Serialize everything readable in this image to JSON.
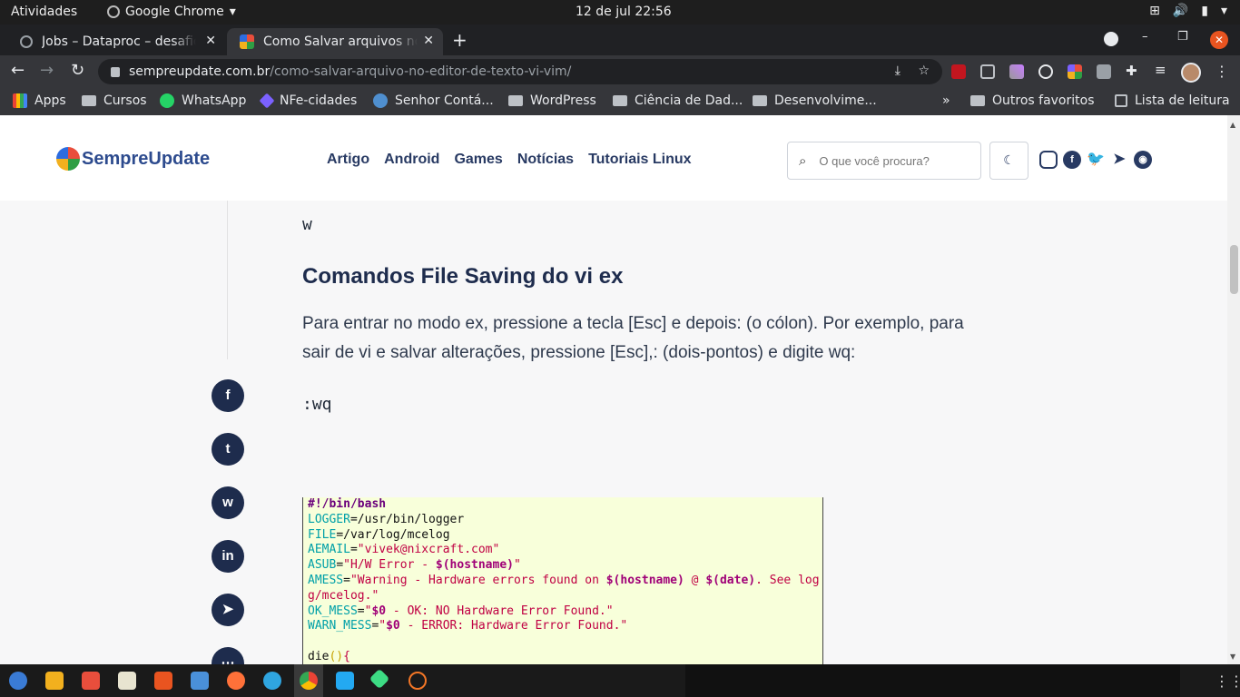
{
  "os": {
    "activities": "Atividades",
    "app_menu": "Google Chrome",
    "clock": "12 de jul  22:56"
  },
  "browser": {
    "tabs": [
      {
        "title": "Jobs – Dataproc – desafio"
      },
      {
        "title": "Como Salvar arquivos no editor"
      }
    ],
    "url_host": "sempreupdate.com.br",
    "url_path": "/como-salvar-arquivo-no-editor-de-texto-vi-vim/",
    "bookmarks": {
      "apps": "Apps",
      "cursos": "Cursos",
      "whatsapp": "WhatsApp",
      "nfe": "NFe-cidades",
      "senhor": "Senhor Contá...",
      "wordpress": "WordPress",
      "ciencia": "Ciência de Dad...",
      "desenv": "Desenvolvime...",
      "more": "»",
      "outros": "Outros favoritos",
      "leitura": "Lista de leitura"
    }
  },
  "site": {
    "logo": "SempreUpdate",
    "menu": [
      "Artigo",
      "Android",
      "Games",
      "Notícias",
      "Tutoriais Linux"
    ],
    "search_placeholder": "O que você procura?"
  },
  "article": {
    "cmd_w": "w",
    "heading": "Comandos File Saving do vi ex",
    "paragraph": "Para entrar no modo ex, pressione a tecla [Esc] e depois: (o cólon). Por exemplo, para sair de vi e salvar alterações, pressione [Esc],: (dois-pontos) e digite wq:",
    "cmd_wq": ":wq",
    "code": {
      "l1": "#!/bin/bash",
      "l2_var": "LOGGER",
      "l2_val": "=/usr/bin/logger",
      "l3_var": "FILE",
      "l3_val": "=/var/log/mcelog",
      "l4_var": "AEMAIL",
      "l4_eq": "=",
      "l4_str": "\"vivek@nixcraft.com\"",
      "l5_var": "ASUB",
      "l5_eq": "=",
      "l5_a": "\"H/W Error - ",
      "l5_sub": "$(hostname)",
      "l5_b": "\"",
      "l6_var": "AMESS",
      "l6_eq": "=",
      "l6_a": "\"Warning - Hardware errors found on ",
      "l6_sub1": "$(hostname)",
      "l6_b": " @ ",
      "l6_sub2": "$(date)",
      "l6_c": ". See log",
      "l7": "g/mcelog.\"",
      "l8_var": "OK_MESS",
      "l8_eq": "=",
      "l8_a": "\"",
      "l8_sub": "$0",
      "l8_b": " - OK: NO Hardware Error Found.\"",
      "l9_var": "WARN_MESS",
      "l9_eq": "=",
      "l9_a": "\"",
      "l9_sub": "$0",
      "l9_b": " - ERROR: Hardware Error Found.\"",
      "l11_fn": "die",
      "l11_paren": "()",
      "l11_brace": "{"
    }
  }
}
